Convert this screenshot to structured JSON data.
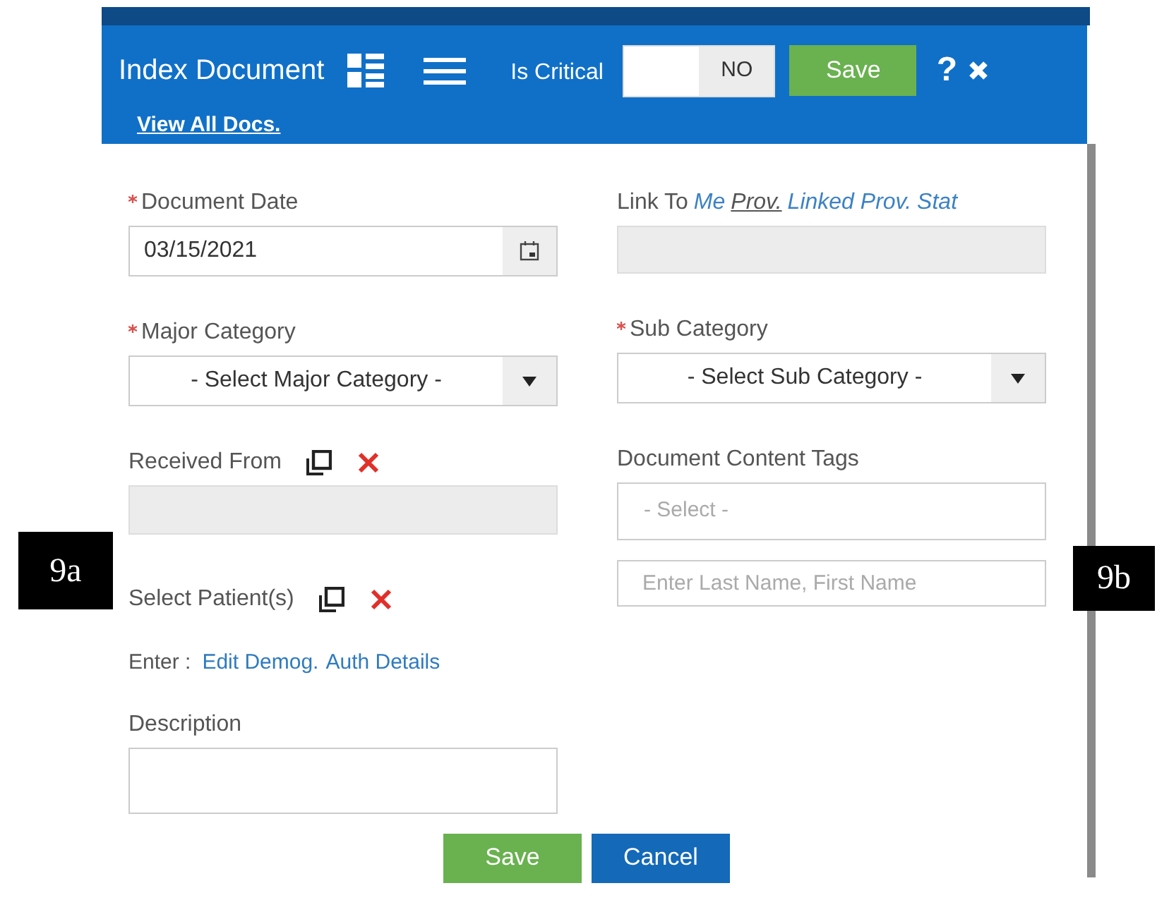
{
  "dialog": {
    "title": "Index Document",
    "view_all_link": "View All Docs.",
    "is_critical": {
      "label": "Is Critical",
      "value": "NO",
      "on": false
    },
    "save_button": "Save",
    "help": "?"
  },
  "left_fields": [
    {
      "kind": "date",
      "label": "Document Date",
      "required": true,
      "value": "03/15/2021"
    },
    {
      "kind": "select",
      "label": "Major Category",
      "required": true,
      "placeholder": "- Select Major Category -"
    },
    {
      "kind": "lookup",
      "label": "Received From",
      "required": false
    },
    {
      "kind": "patient",
      "label": "Select Patient(s)",
      "required": false
    },
    {
      "kind": "links",
      "label": "Enter :",
      "links": [
        {
          "text": "Edit Demog."
        },
        {
          "text": "Auth Details"
        }
      ]
    },
    {
      "kind": "textarea",
      "label": "Description",
      "required": false
    }
  ],
  "right_fields": [
    {
      "kind": "linkto",
      "label": "Link To",
      "links": [
        {
          "text": "Me",
          "selected": false
        },
        {
          "text": "Prov.",
          "selected": true
        },
        {
          "text": "Linked Prov.",
          "selected": false
        },
        {
          "text": "Stat",
          "selected": false
        }
      ]
    },
    {
      "kind": "select",
      "label": "Sub Category",
      "required": true,
      "placeholder": "- Select Sub Category -"
    },
    {
      "kind": "multiselect",
      "label": "Document Content Tags",
      "required": false,
      "placeholder": "- Select -"
    },
    {
      "kind": "name",
      "placeholder": "Enter Last Name, First Name"
    }
  ],
  "buttons": [
    {
      "label": "Save",
      "kind": "primary"
    },
    {
      "label": "Cancel",
      "kind": "secondary"
    }
  ],
  "callouts": [
    {
      "text": "9a"
    },
    {
      "text": "9b"
    }
  ]
}
